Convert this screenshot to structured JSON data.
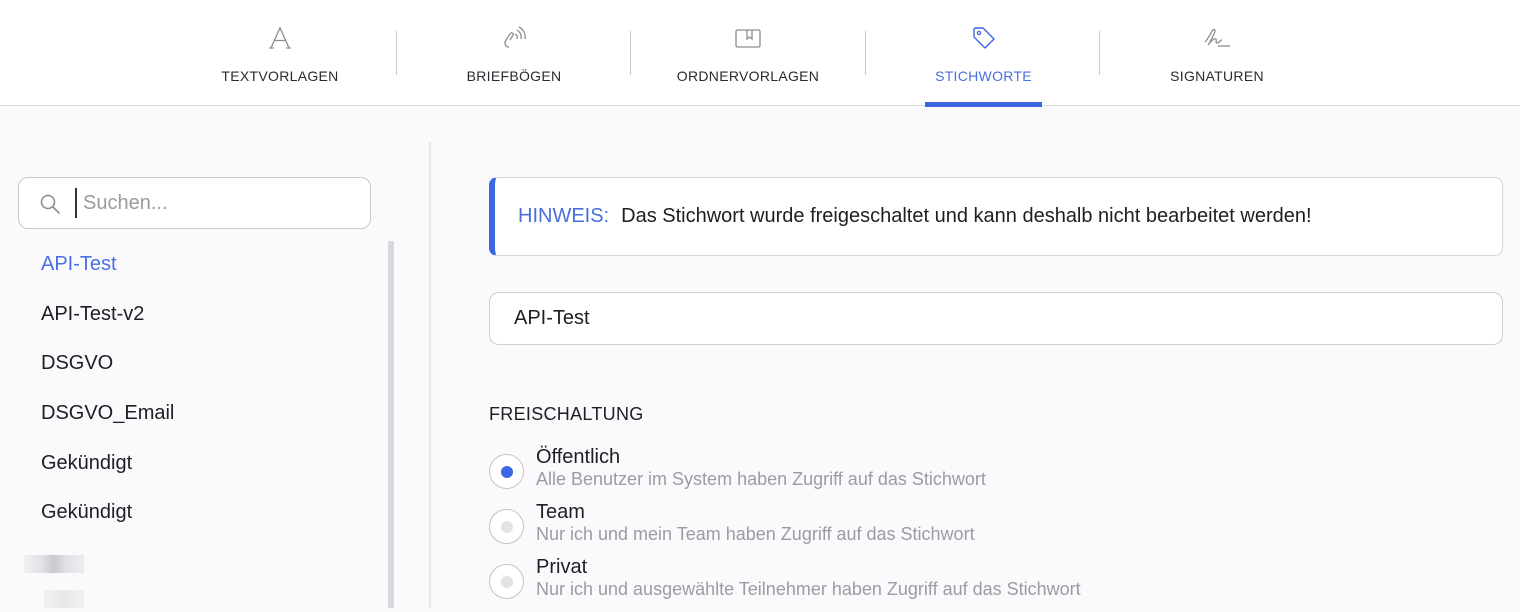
{
  "tabs": [
    {
      "label": "TEXTVORLAGEN",
      "icon": "text-template-icon",
      "active": false
    },
    {
      "label": "BRIEFBÖGEN",
      "icon": "letterhead-icon",
      "active": false
    },
    {
      "label": "ORDNERVORLAGEN",
      "icon": "folder-template-icon",
      "active": false
    },
    {
      "label": "STICHWORTE",
      "icon": "tag-icon",
      "active": true
    },
    {
      "label": "SIGNATUREN",
      "icon": "signature-icon",
      "active": false
    }
  ],
  "sidebar": {
    "search": {
      "placeholder": "Suchen...",
      "value": ""
    },
    "items": [
      {
        "label": "API-Test",
        "selected": true
      },
      {
        "label": "API-Test-v2",
        "selected": false
      },
      {
        "label": "DSGVO",
        "selected": false
      },
      {
        "label": "DSGVO_Email",
        "selected": false
      },
      {
        "label": "Gekündigt",
        "selected": false
      },
      {
        "label": "Gekündigt",
        "selected": false
      }
    ]
  },
  "main": {
    "notice": {
      "label": "HINWEIS:",
      "text": "Das Stichwort wurde freigeschaltet und kann deshalb nicht bearbeitet werden!"
    },
    "name_value": "API-Test",
    "section_title": "FREISCHALTUNG",
    "options": [
      {
        "title": "Öffentlich",
        "description": "Alle Benutzer im System haben Zugriff auf das Stichwort",
        "checked": true
      },
      {
        "title": "Team",
        "description": "Nur ich und mein Team haben Zugriff auf das Stichwort",
        "checked": false
      },
      {
        "title": "Privat",
        "description": "Nur ich und ausgewählte Teilnehmer haben Zugriff auf das Stichwort",
        "checked": false
      }
    ]
  },
  "colors": {
    "accent": "#3b67e2",
    "accent_text": "#4a6ee0",
    "muted": "#9b9ba1"
  }
}
